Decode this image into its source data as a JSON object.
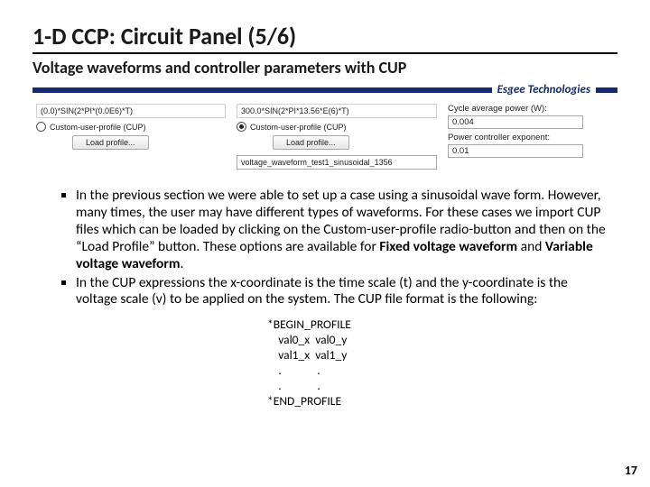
{
  "header": {
    "title": "1-D CCP: Circuit Panel (5/6)",
    "subtitle": "Voltage waveforms and controller parameters with CUP",
    "brand": "Esgee Technologies"
  },
  "panel": {
    "left": {
      "expr": "(0.0)*SIN(2*PI*(0.0E6)*T)",
      "radio_label": "Custom-user-profile (CUP)",
      "radio_checked": false,
      "load_btn": "Load profile..."
    },
    "mid": {
      "expr": "300.0*SIN(2*PI*13.56*E(6)*T)",
      "radio_label": "Custom-user-profile (CUP)",
      "radio_checked": true,
      "load_btn": "Load profile...",
      "file": "voltage_waveform_test1_sinusoidal_1356"
    },
    "right": {
      "field1_label": "Cycle average power (W):",
      "field1_value": "0.004",
      "field2_label": "Power controller exponent:",
      "field2_value": "0.01"
    }
  },
  "bullets": {
    "b1a": "In the previous section we were able to set up a case using a sinusoidal wave form. However, many times, the user may have different types of waveforms. For these cases we import CUP files which can be loaded by clicking on the Custom-user-profile radio-button and then on the “Load Profile” button. These options are available for ",
    "b1b": "Fixed voltage waveform",
    "b1c": " and ",
    "b1d": "Variable voltage waveform",
    "b1e": ".",
    "b2": "In the CUP expressions the x-coordinate is the time scale (t) and the y-coordinate is the voltage scale (v) to be applied on the system. The CUP file format is the following:"
  },
  "code": {
    "l1": "*BEGIN_PROFILE",
    "l2": "    val0_x  val0_y",
    "l3": "    val1_x  val1_y",
    "l4": "    .             .",
    "l5": "    .             .",
    "l6": "*END_PROFILE"
  },
  "page_number": "17"
}
